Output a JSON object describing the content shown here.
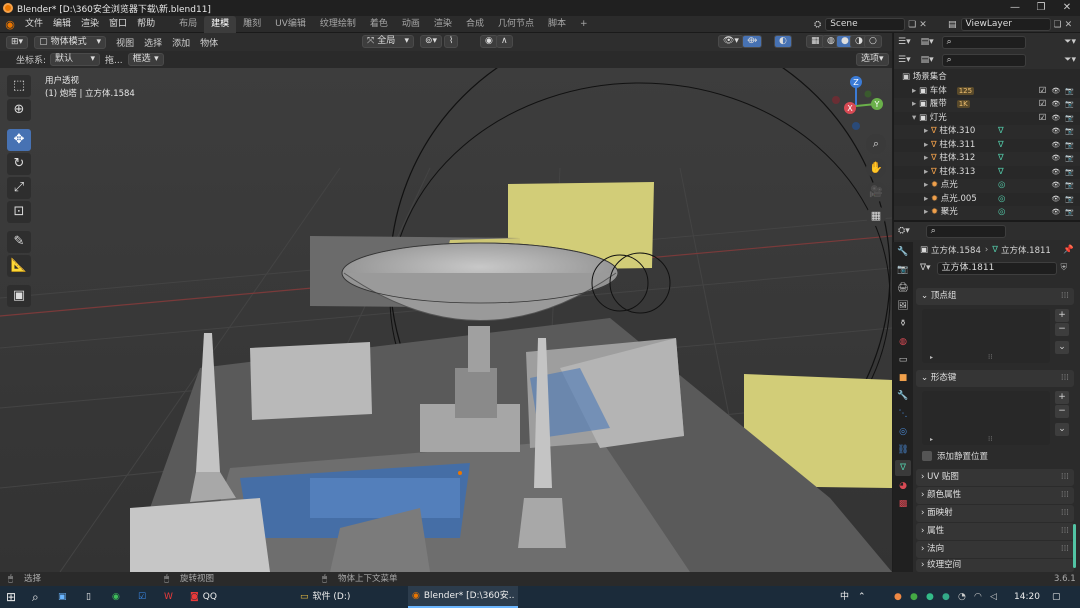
{
  "app": {
    "title": "Blender* [D:\\360安全浏览器下载\\新.blend11]"
  },
  "menu": {
    "items": [
      "文件",
      "编辑",
      "渲染",
      "窗口",
      "帮助"
    ],
    "workspaces": [
      "布局",
      "建模",
      "雕刻",
      "UV编辑",
      "纹理绘制",
      "着色",
      "动画",
      "渲染",
      "合成",
      "几何节点",
      "脚本"
    ],
    "active_workspace": "建模",
    "add_tab": "+",
    "scene": "Scene",
    "view_layer": "ViewLayer"
  },
  "viewport_header": {
    "mode": "物体模式",
    "menus": [
      "视图",
      "选择",
      "添加",
      "物体"
    ],
    "transform_orientation": "全局",
    "coord_label": "坐标系:",
    "coord_value": "默认",
    "drag_label": "拖...",
    "select_mode": "框选",
    "options": "选项"
  },
  "viewport": {
    "view_name": "用户透视",
    "object_info": "(1) 炮塔 | 立方体.1584",
    "gizmo": {
      "x": "X",
      "y": "Y",
      "z": "Z"
    }
  },
  "outliner": {
    "search_placeholder": "",
    "root": "场景集合",
    "items": [
      {
        "label": "车体",
        "badge": "125",
        "indent": 1
      },
      {
        "label": "履带",
        "badge": "1K",
        "indent": 1
      },
      {
        "label": "灯光",
        "badge": "",
        "indent": 1
      },
      {
        "label": "柱体.310",
        "badge": "",
        "indent": 2
      },
      {
        "label": "柱体.311",
        "badge": "",
        "indent": 2
      },
      {
        "label": "柱体.312",
        "badge": "",
        "indent": 2
      },
      {
        "label": "柱体.313",
        "badge": "",
        "indent": 2
      },
      {
        "label": "点光",
        "badge": "",
        "indent": 2
      },
      {
        "label": "点光.005",
        "badge": "",
        "indent": 2
      },
      {
        "label": "聚光",
        "badge": "",
        "indent": 2
      }
    ]
  },
  "properties": {
    "breadcrumb_object": "立方体.1584",
    "breadcrumb_data": "立方体.1811",
    "data_name": "立方体.1811",
    "panels": {
      "vertex_groups": "顶点组",
      "shape_keys": "形态键",
      "relative_label": "添加静置位置",
      "uv_maps": "UV 贴图",
      "color_attributes": "颜色属性",
      "face_maps": "面映射",
      "attributes": "属性",
      "normals": "法向",
      "texture_space": "纹理空间"
    }
  },
  "statusbar": {
    "select": "选择",
    "rotate": "旋转视图",
    "context_menu": "物体上下文菜单",
    "version": "3.6.1"
  },
  "taskbar": {
    "qq": "QQ",
    "explorer": "软件 (D:)",
    "blender": "Blender* [D:\\360安...",
    "ime": "中",
    "time": "14:20"
  },
  "colors": {
    "accent": "#4772b3",
    "blender_orange": "#ea7600",
    "viewport_bg": "#393939",
    "light_yellow": "#d2cd78"
  }
}
